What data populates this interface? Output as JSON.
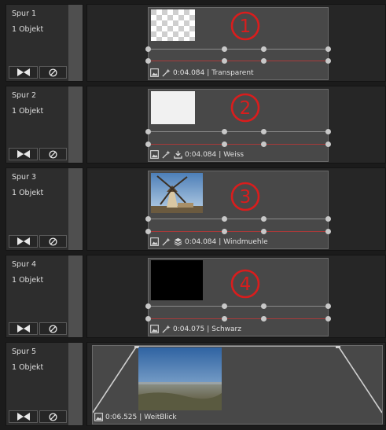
{
  "tracks": [
    {
      "name": "Spur 1",
      "count": "1 Objekt",
      "duration": "0:04.084",
      "clip_label": "Transparent",
      "badge": "1",
      "effect_icon": "magic-wand-icon"
    },
    {
      "name": "Spur 2",
      "count": "1 Objekt",
      "duration": "0:04.084",
      "clip_label": "Weiss",
      "badge": "2",
      "effect_icon": "download-icon"
    },
    {
      "name": "Spur 3",
      "count": "1 Objekt",
      "duration": "0:04.084",
      "clip_label": "Windmuehle",
      "badge": "3",
      "effect_icon": "layers-icon"
    },
    {
      "name": "Spur 4",
      "count": "1 Objekt",
      "duration": "0:04.075",
      "clip_label": "Schwarz",
      "badge": "4",
      "effect_icon": "magic-wand-icon"
    },
    {
      "name": "Spur 5",
      "count": "1 Objekt",
      "duration": "0:06.525",
      "clip_label": "WeitBlick"
    }
  ],
  "separator": "|",
  "colors": {
    "accent_red": "#d91d1d",
    "keyframe_line_red": "#a83a3a",
    "keyframe_line_gray": "#8a8a8a"
  }
}
